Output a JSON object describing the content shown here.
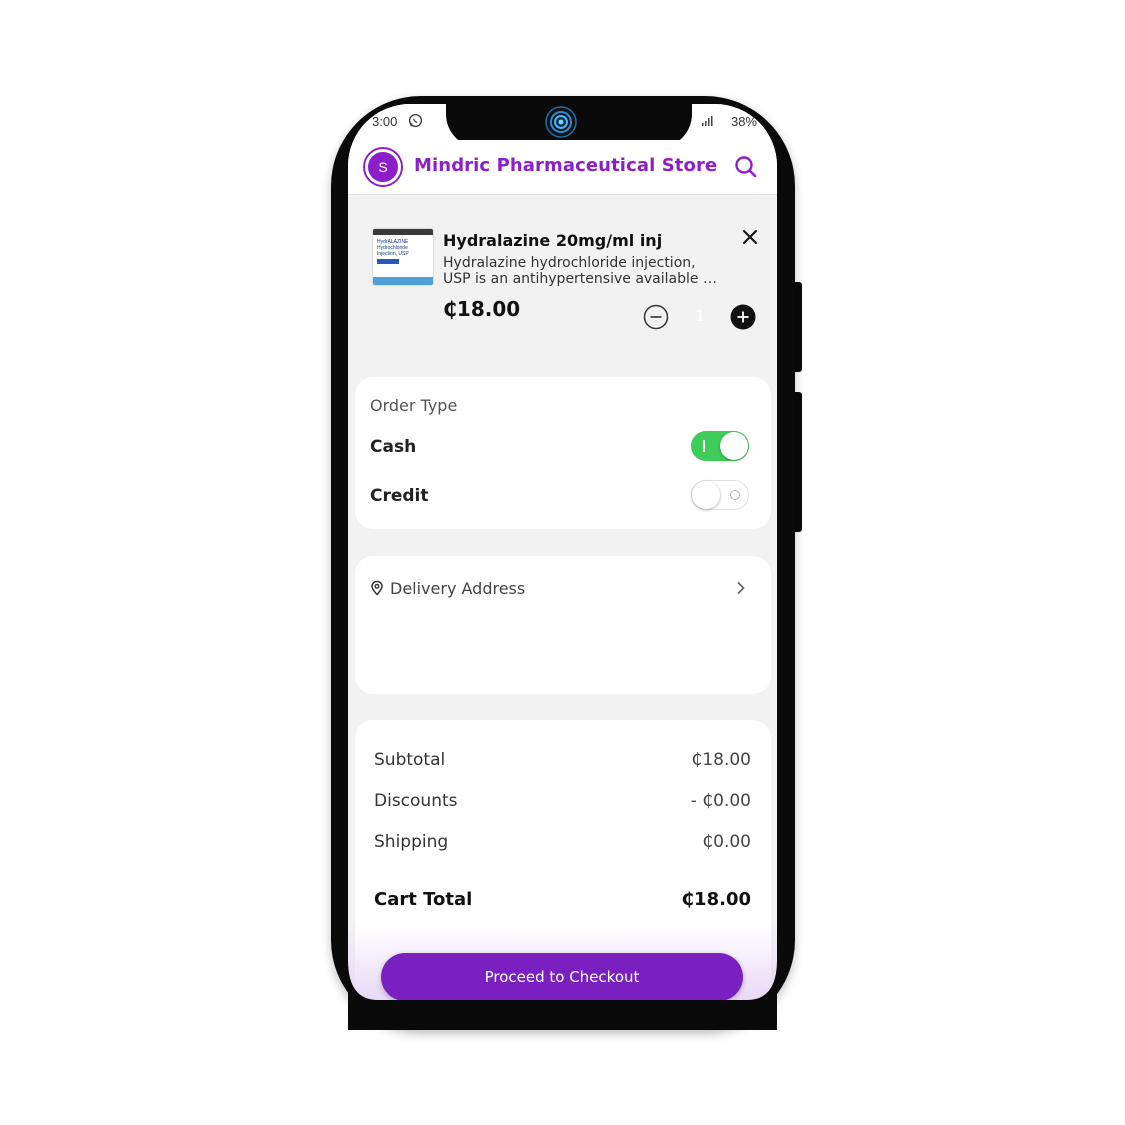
{
  "status_bar": {
    "time": "3:00",
    "battery": "38%",
    "icons": [
      "whatsapp-icon",
      "signal-icon"
    ]
  },
  "header": {
    "avatar_letter": "S",
    "store_name": "Mindric Pharmaceutical Store",
    "search_icon": "search-icon"
  },
  "cart_item": {
    "name": "Hydralazine 20mg/ml inj",
    "description_line1": "Hydralazine hydrochloride injection,",
    "description_line2": "USP is an antihypertensive available …",
    "price": "₵18.00",
    "quantity": "1",
    "thumbnail_text": "HydrALAZINE Hydrochloride Injection, USP"
  },
  "order_type": {
    "title": "Order Type",
    "options": [
      {
        "label": "Cash",
        "enabled": true
      },
      {
        "label": "Credit",
        "enabled": false
      }
    ]
  },
  "delivery": {
    "label": "Delivery Address"
  },
  "summary": {
    "subtotal_label": "Subtotal",
    "subtotal_value": "₵18.00",
    "discounts_label": "Discounts",
    "discounts_value": "- ₵0.00",
    "shipping_label": "Shipping",
    "shipping_value": "₵0.00",
    "total_label": "Cart Total",
    "total_value": "₵18.00"
  },
  "checkout": {
    "label": "Proceed to Checkout"
  },
  "colors": {
    "brand": "#8c1fc9",
    "button": "#7a1fc0",
    "toggle_on": "#3fcd59"
  }
}
